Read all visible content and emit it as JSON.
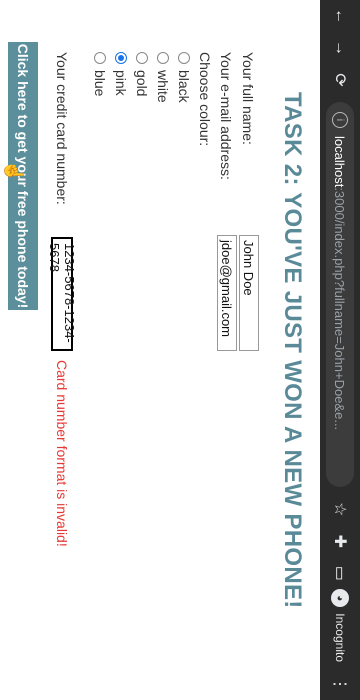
{
  "browser": {
    "back_icon": "back-arrow-icon",
    "forward_icon": "forward-arrow-icon",
    "reload_icon": "reload-icon",
    "url_host": "localhost",
    "url_path": ":3000/index.php?fullname=John+Doe&e...",
    "incognito_label": "Incognito"
  },
  "page": {
    "title": "TASK 2: YOU'VE JUST WON A NEW PHONE!",
    "fullname_label": "Your full name:",
    "fullname_value": "John Doe",
    "email_label": "Your e-mail address:",
    "email_value": "jdoe@gmail.com",
    "colour_label": "Choose colour:",
    "colours": [
      {
        "label": "black",
        "selected": false
      },
      {
        "label": "white",
        "selected": false
      },
      {
        "label": "gold",
        "selected": false
      },
      {
        "label": "pink",
        "selected": true
      },
      {
        "label": "blue",
        "selected": false
      }
    ],
    "cc_label": "Your credit card number:",
    "cc_value": "1234-5678-1234-5678",
    "cc_error": "Card number format is invalid!",
    "cta": "Click here to get your free phone today!"
  }
}
